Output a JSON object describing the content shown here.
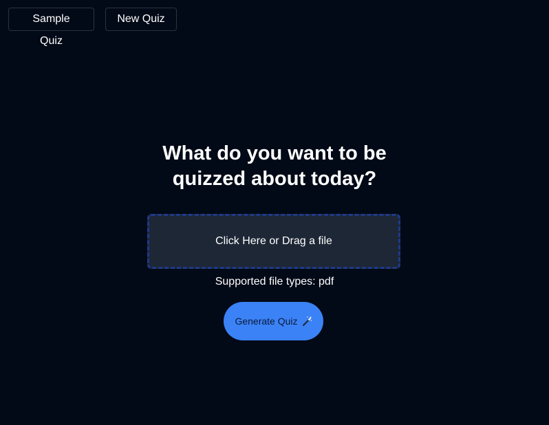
{
  "header": {
    "sample_quiz_label": "Sample Quiz",
    "new_quiz_label": "New Quiz"
  },
  "main": {
    "title_line1": "What do you want to be",
    "title_line2": "quizzed about today?",
    "dropzone_label": "Click Here or Drag a file",
    "supported_types": "Supported file types: pdf",
    "generate_label": "Generate Quiz",
    "generate_icon": "magic-wand-icon"
  },
  "colors": {
    "background": "#030a17",
    "accent": "#3b82f6",
    "dropzone_bg": "#1e2736",
    "dropzone_border": "#1e3a8a"
  }
}
